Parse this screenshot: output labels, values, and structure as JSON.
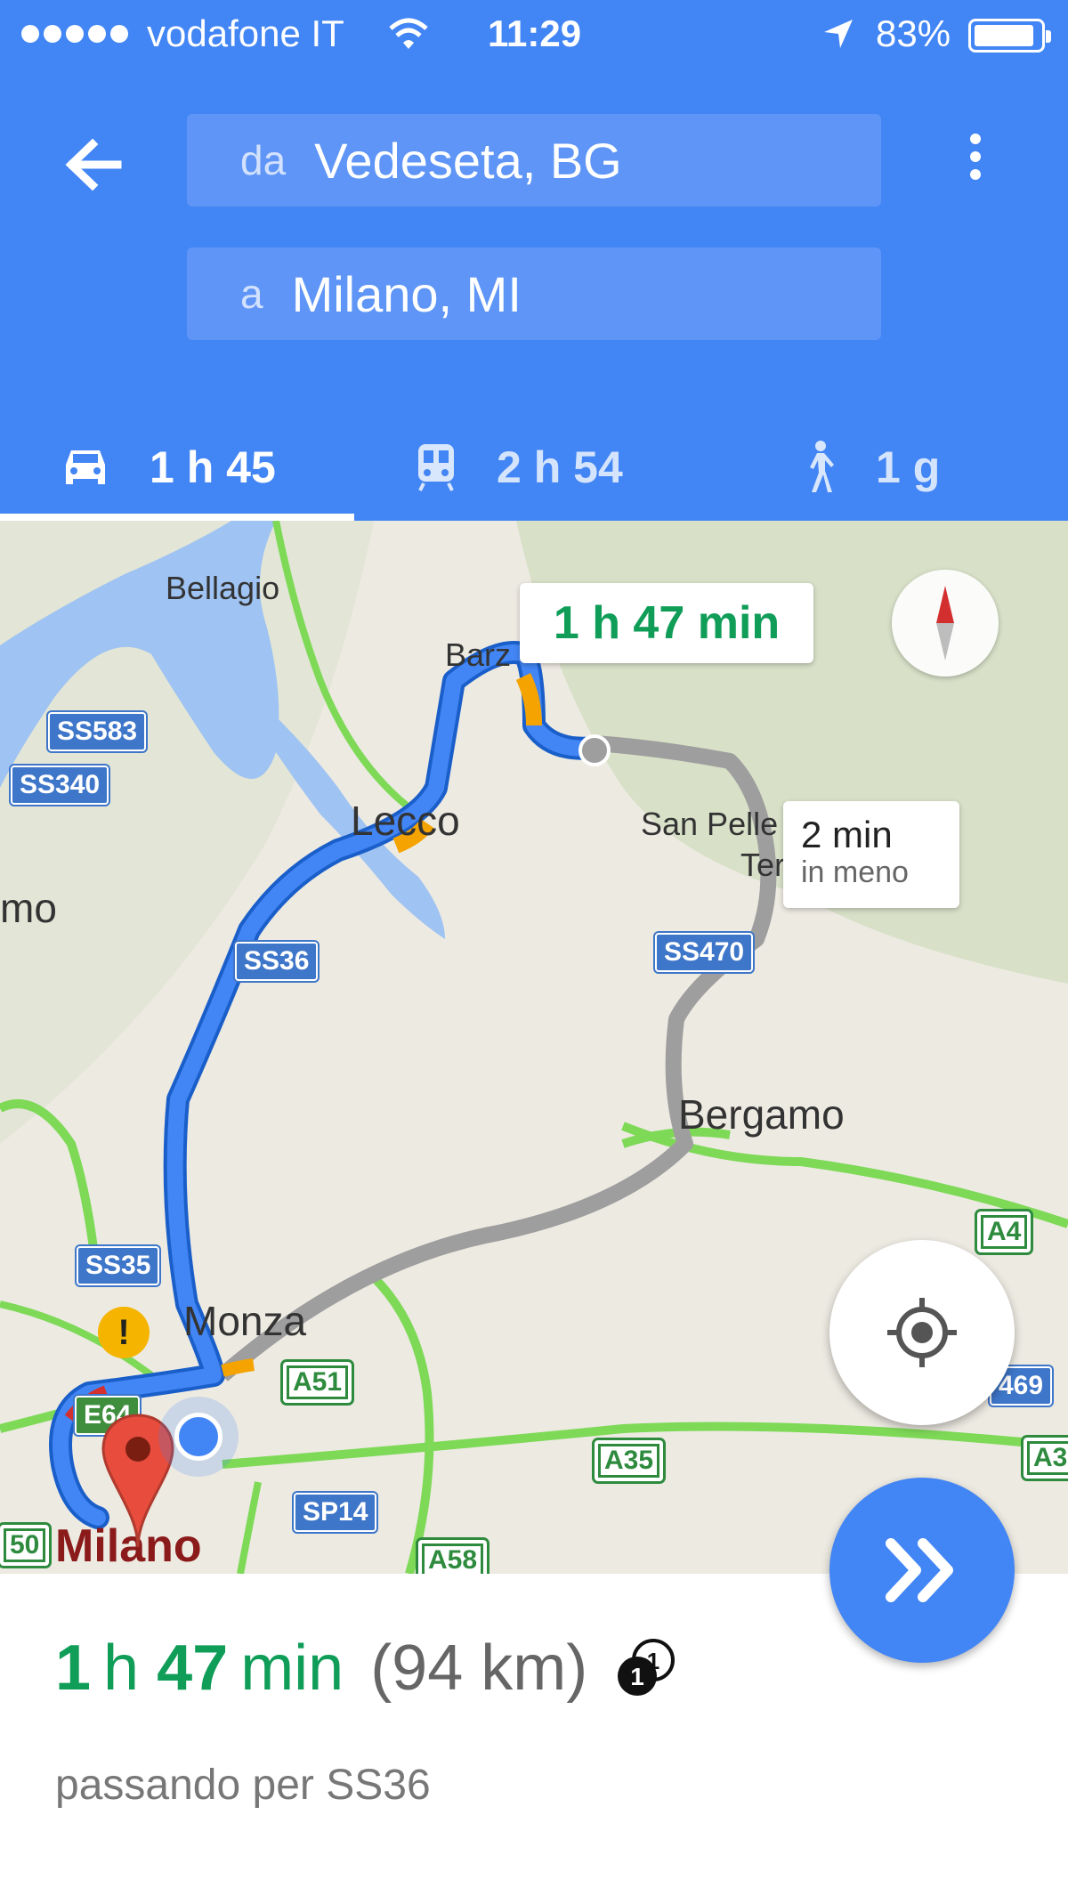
{
  "status_bar": {
    "carrier": "vodafone IT",
    "time": "11:29",
    "battery": "83%",
    "battery_level": 0.83
  },
  "header": {
    "from_prefix": "da",
    "from_value": "Vedeseta, BG",
    "to_prefix": "a",
    "to_value": "Milano, MI"
  },
  "modes": [
    {
      "icon": "car-icon",
      "label": "1 h 45",
      "selected": true
    },
    {
      "icon": "train-icon",
      "label": "2 h 54",
      "selected": false
    },
    {
      "icon": "walk-icon",
      "label": "1 g",
      "selected": false
    }
  ],
  "map": {
    "places": {
      "bellagio": "Bellagio",
      "barzio": "Barz",
      "lecco": "Lecco",
      "san_pellegrino": "San Pelle",
      "terme": "Term",
      "como": "mo",
      "bergamo": "Bergamo",
      "monza": "Monza",
      "milano": "Milano"
    },
    "road_shields": {
      "ss583": "SS583",
      "ss340": "SS340",
      "ss36": "SS36",
      "ss470": "SS470",
      "ss35": "SS35",
      "e64": "E64",
      "a51": "A51",
      "a35": "A35",
      "sp14": "SP14",
      "a58": "A58",
      "a4": "A4",
      "r469": "469",
      "a3": "A3",
      "r50": "50"
    },
    "main_route_callout": "1 h 47 min",
    "alt_route_callout_line1": "2 min",
    "alt_route_callout_line2": "in meno",
    "colors": {
      "route": "#4285F4",
      "alt_route": "#9E9E9E",
      "traffic_slow": "#F4A300",
      "traffic_jam": "#D32F2F",
      "highway": "#7ED957"
    }
  },
  "sheet": {
    "hours": "1",
    "hours_unit": "h",
    "minutes": "47",
    "minutes_unit": "min",
    "distance": "(94 km)",
    "via": "passando per SS36"
  },
  "accent": "#4285F4",
  "success": "#0F9D58"
}
